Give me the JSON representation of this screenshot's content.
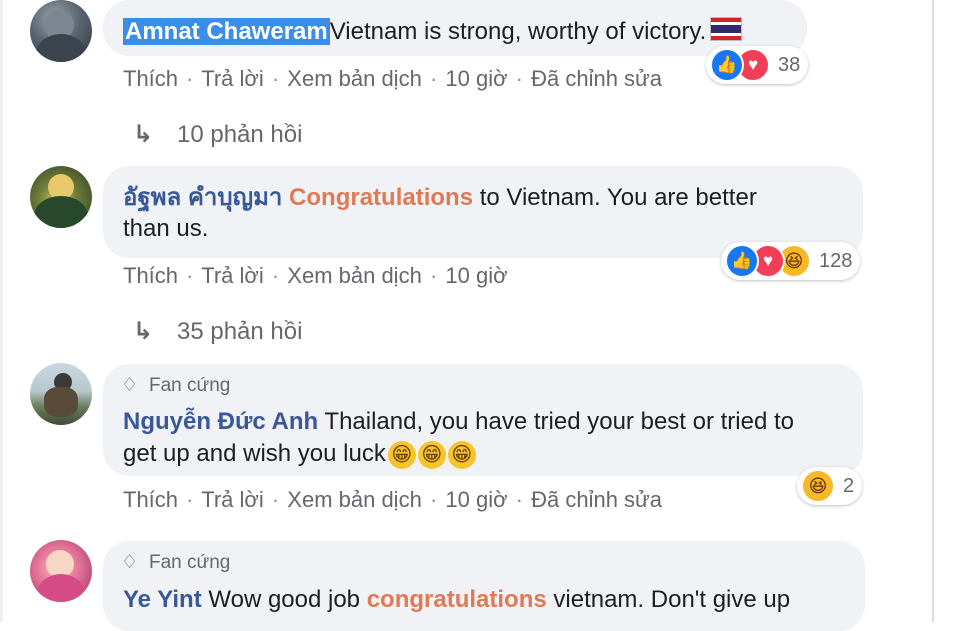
{
  "comments": [
    {
      "author": "Amnat Chaweram",
      "text": "Vietnam is strong, worthy of victory.",
      "actions": {
        "like": "Thích",
        "reply": "Trả lời",
        "translate": "Xem bản dịch",
        "time": "10 giờ",
        "edited": "Đã chỉnh sửa"
      },
      "reactions": {
        "count": "38",
        "types": [
          "like-icon",
          "love-icon"
        ]
      },
      "replies": "10 phản hồi"
    },
    {
      "author": "อัฐพล คำบุญมา",
      "highlight": "Congratulations",
      "text_line1": " to Vietnam. You are better",
      "text_line2": "than us.",
      "actions": {
        "like": "Thích",
        "reply": "Trả lời",
        "translate": "Xem bản dịch",
        "time": "10 giờ"
      },
      "reactions": {
        "count": "128",
        "types": [
          "like-icon",
          "love-icon",
          "haha-icon"
        ]
      },
      "replies": "35 phản hồi"
    },
    {
      "badge": "Fan cứng",
      "author": "Nguyễn Đức Anh",
      "text_line1": " Thailand, you have tried your best or tried to",
      "text_line2": "get up and wish you luck",
      "actions": {
        "like": "Thích",
        "reply": "Trả lời",
        "translate": "Xem bản dịch",
        "time": "10 giờ",
        "edited": "Đã chỉnh sửa"
      },
      "reactions": {
        "count": "2",
        "types": [
          "haha-icon"
        ]
      }
    },
    {
      "badge": "Fan cứng",
      "author": "Ye Yint",
      "text_pre": " Wow good job ",
      "highlight": "congratulations",
      "text_post": " vietnam. Don't give up"
    }
  ],
  "glyphs": {
    "separator": "·",
    "reply_arrow": "↳",
    "badge_icon": "♢",
    "grin": "😁",
    "haha": "😆",
    "like": "👍",
    "love": "♥"
  },
  "colors": {
    "bubble": "#f0f2f5",
    "name": "#385898",
    "highlight": "#e07a54",
    "selection": "#3a8ee6",
    "like": "#1877f2",
    "love": "#f33e58",
    "haha": "#f7b928"
  }
}
